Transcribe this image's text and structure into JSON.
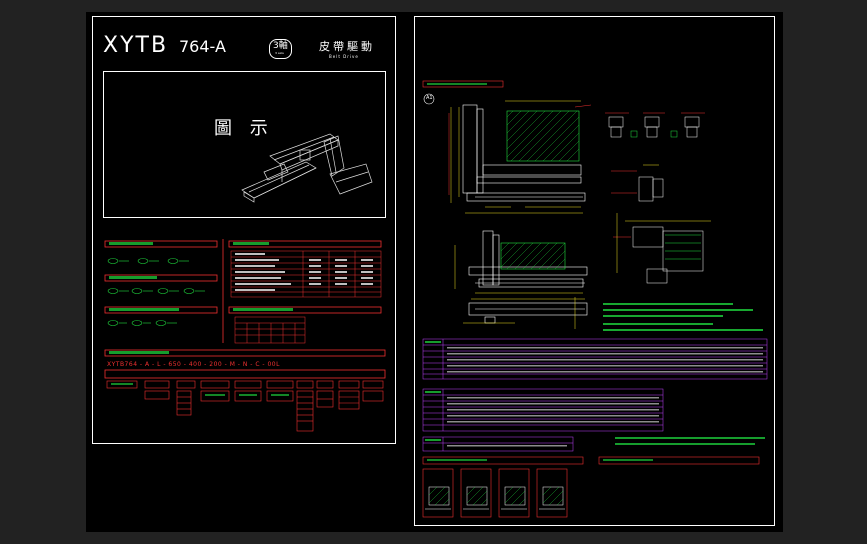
{
  "left_sheet": {
    "model": "XYTB",
    "model_number": "764-A",
    "axis_badge": "3軸",
    "axis_badge_sub": "3 axis",
    "drive_type": "皮帶驅動",
    "drive_type_en": "Belt Drive",
    "figure_label": "圖 示",
    "order_code": "XYTB764 - A  -  L  -  650  -  400  -  200  -  M  -  N  -  C  -  00L"
  },
  "right_sheet": {
    "detail_marker": "A1"
  },
  "colors": {
    "background": "#000000",
    "border": "#ffffff",
    "section_frame": "#f03030",
    "text_green": "#20e040",
    "dimension": "#f0e020",
    "table_grid": "#c040ff"
  }
}
